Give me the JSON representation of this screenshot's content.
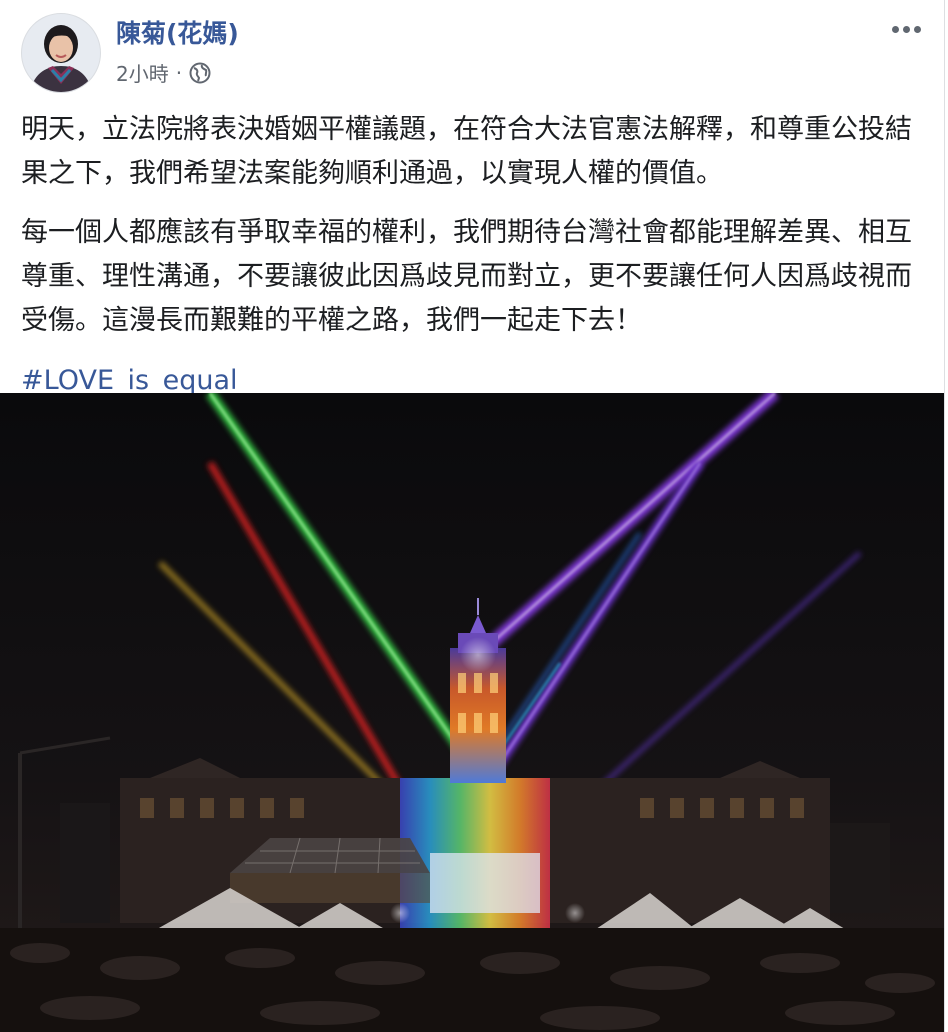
{
  "post": {
    "author_name": "陳菊(花媽)",
    "timestamp": "2小時",
    "separator": "·",
    "audience_icon": "globe-icon",
    "more_icon": "more-options-icon",
    "paragraphs": [
      "明天，立法院將表決婚姻平權議題，在符合大法官憲法解釋，和尊重公投結果之下，我們希望法案能夠順利通過，以實現人權的價值。",
      "每一個人都應該有爭取幸福的權利，我們期待台灣社會都能理解差異、相互尊重、理性溝通，不要讓彼此因爲歧見而對立，更不要讓任何人因爲歧視而受傷。這漫長而艱難的平權之路，我們一起走下去！"
    ],
    "hashtag": "#LOVE_is_equal",
    "photo_subject": "rainbow-laser-light-show-over-presidential-office"
  },
  "colors": {
    "link_blue": "#385898",
    "meta_gray": "#616770",
    "text": "#1c1e21"
  }
}
